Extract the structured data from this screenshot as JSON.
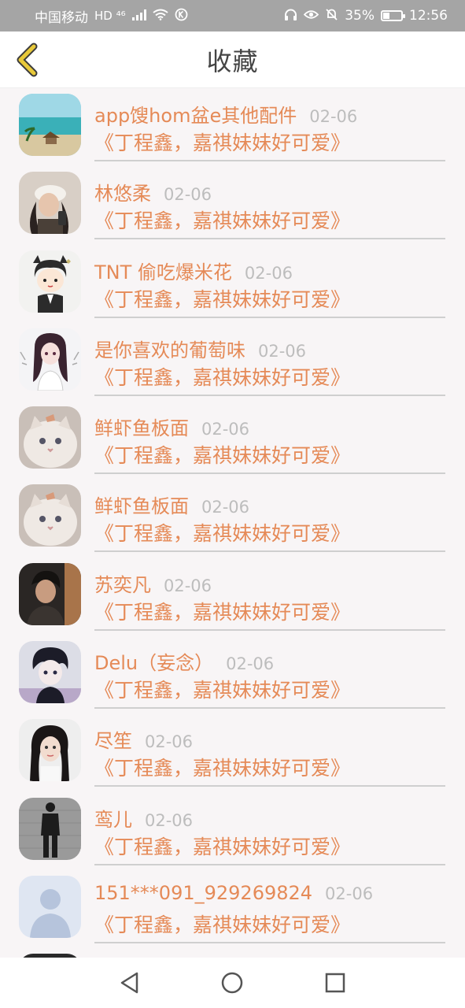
{
  "status_bar": {
    "carrier": "中国移动",
    "network_badges": "HD ⁴⁶",
    "battery_pct": "35%",
    "battery_level": 0.35,
    "time": "12:56"
  },
  "header": {
    "title": "收藏",
    "back_icon": "chevron-left-icon",
    "accent_color": "#e8c93a"
  },
  "favorites": [
    {
      "name": "app馊hom盆e其他配件",
      "date": "02-06",
      "title": "《丁程鑫，嘉祺妹妹好可爱》",
      "avatar": "beach-photo"
    },
    {
      "name": "林悠柔",
      "date": "02-06",
      "title": "《丁程鑫，嘉祺妹妹好可爱》",
      "avatar": "girl-cap-photo"
    },
    {
      "name": "TNT 偷吃爆米花",
      "date": "02-06",
      "title": "《丁程鑫，嘉祺妹妹好可爱》",
      "avatar": "cartoon-boy"
    },
    {
      "name": "是你喜欢的葡萄味",
      "date": "02-06",
      "title": "《丁程鑫，嘉祺妹妹好可爱》",
      "avatar": "anime-girl"
    },
    {
      "name": "鲜虾鱼板面",
      "date": "02-06",
      "title": "《丁程鑫，嘉祺妹妹好可爱》",
      "avatar": "white-cat"
    },
    {
      "name": "鲜虾鱼板面",
      "date": "02-06",
      "title": "《丁程鑫，嘉祺妹妹好可爱》",
      "avatar": "white-cat"
    },
    {
      "name": "苏奕凡",
      "date": "02-06",
      "title": "《丁程鑫，嘉祺妹妹好可爱》",
      "avatar": "boy-dark-photo"
    },
    {
      "name": "Delu（妄念）",
      "date": "02-06",
      "title": "《丁程鑫，嘉祺妹妹好可爱》",
      "avatar": "anime-boy"
    },
    {
      "name": "尽笙",
      "date": "02-06",
      "title": "《丁程鑫，嘉祺妹妹好可爱》",
      "avatar": "girl-selfie"
    },
    {
      "name": "鸾儿",
      "date": "02-06",
      "title": "《丁程鑫，嘉祺妹妹好可爱》",
      "avatar": "black-outfit-photo"
    },
    {
      "name": "151***091_929269824",
      "date": "02-06",
      "title": "《丁程鑫，嘉祺妹妹好可爱》",
      "avatar": "default-avatar"
    }
  ],
  "nav_bar": {
    "back": "triangle-back-icon",
    "home": "circle-home-icon",
    "recents": "square-recents-icon"
  }
}
